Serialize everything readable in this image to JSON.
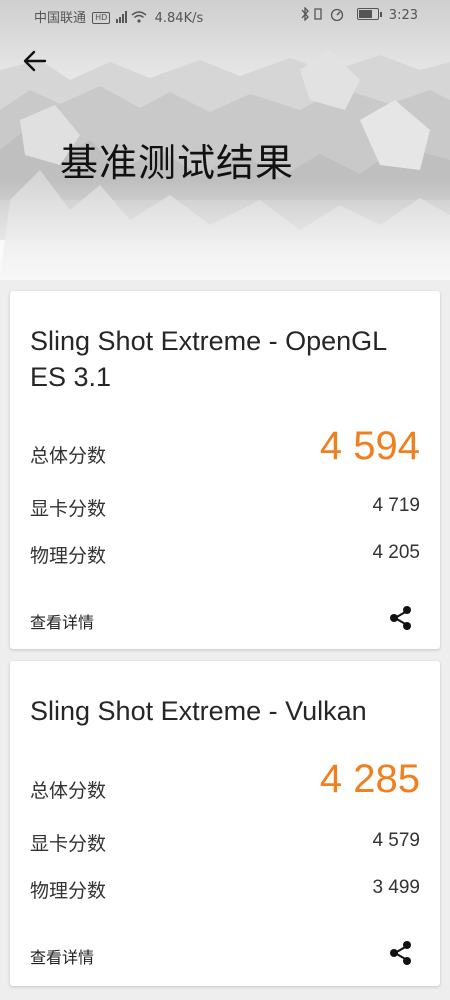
{
  "status_bar": {
    "carrier": "中国联通",
    "hd_badge": "HD",
    "net_speed": "4.84K/s",
    "time": "3:23"
  },
  "header": {
    "title": "基准测试结果",
    "back_icon": "arrow-left-icon"
  },
  "results": [
    {
      "test_name": "Sling Shot Extreme - OpenGL ES 3.1",
      "overall_label": "总体分数",
      "overall_score": "4 594",
      "graphics_label": "显卡分数",
      "graphics_score": "4 719",
      "physics_label": "物理分数",
      "physics_score": "4 205",
      "details_label": "查看详情",
      "share_icon": "share-icon"
    },
    {
      "test_name": "Sling Shot Extreme - Vulkan",
      "overall_label": "总体分数",
      "overall_score": "4 285",
      "graphics_label": "显卡分数",
      "graphics_score": "4 579",
      "physics_label": "物理分数",
      "physics_score": "3 499",
      "details_label": "查看详情",
      "share_icon": "share-icon"
    }
  ],
  "colors": {
    "score_accent": "#f07f1e",
    "background": "#eeeeee"
  }
}
